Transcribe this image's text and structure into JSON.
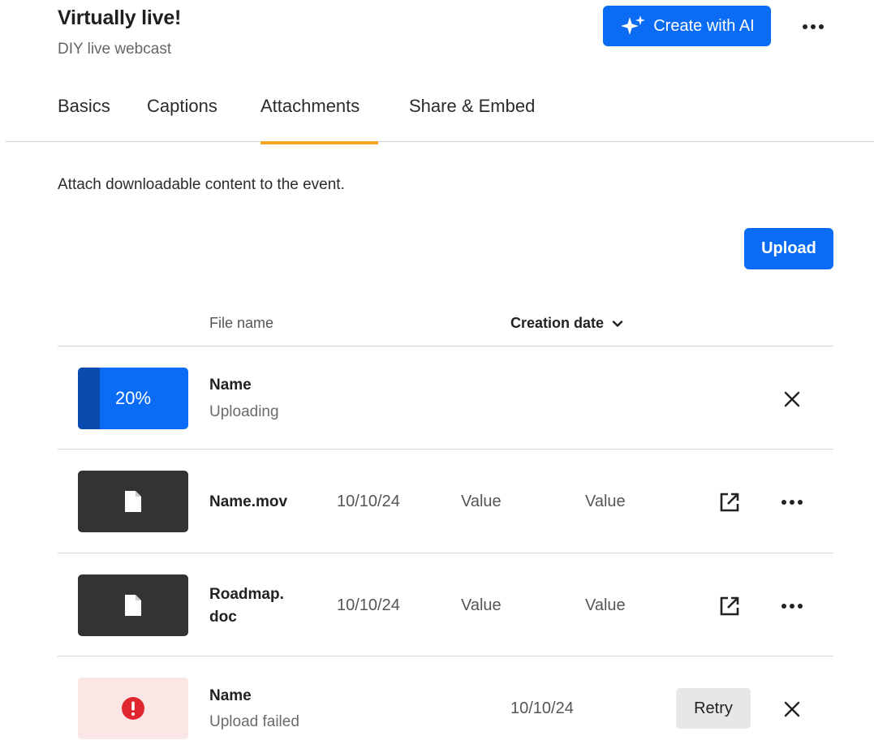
{
  "header": {
    "title": "Virtually live!",
    "subtitle": "DIY live webcast",
    "ai_button_label": "Create with AI",
    "ai_icon": "sparkles-icon",
    "more_icon": "ellipsis-icon"
  },
  "tabs": [
    {
      "label": "Basics",
      "active": false
    },
    {
      "label": "Captions",
      "active": false
    },
    {
      "label": "Attachments",
      "active": true
    },
    {
      "label": "Share & Embed",
      "active": false
    }
  ],
  "description": "Attach downloadable content to the event.",
  "upload_label": "Upload",
  "table": {
    "columns": {
      "file_name": "File name",
      "creation_date": "Creation date",
      "sort_icon": "chevron-down-icon"
    },
    "rows": [
      {
        "state": "uploading",
        "name": "Name",
        "status": "Uploading",
        "progress_label": "20%",
        "progress": 0.2
      },
      {
        "state": "done",
        "name": "Name.mov",
        "date": "10/10/24",
        "col3": "Value",
        "col4": "Value",
        "icon": "file-icon"
      },
      {
        "state": "done",
        "name_line1": "Roadmap.",
        "name_line2": "doc",
        "date": "10/10/24",
        "col3": "Value",
        "col4": "Value",
        "icon": "file-icon"
      },
      {
        "state": "failed",
        "name": "Name",
        "status": "Upload failed",
        "date": "10/10/24",
        "retry_label": "Retry",
        "icon": "error-icon"
      }
    ]
  },
  "colors": {
    "primary": "#0a6cf5",
    "progress_fill": "#0a4bb0",
    "tab_indicator": "#f5a623",
    "error": "#e0262d",
    "error_bg": "#fbe6e6",
    "thumb_dark": "#333333"
  }
}
